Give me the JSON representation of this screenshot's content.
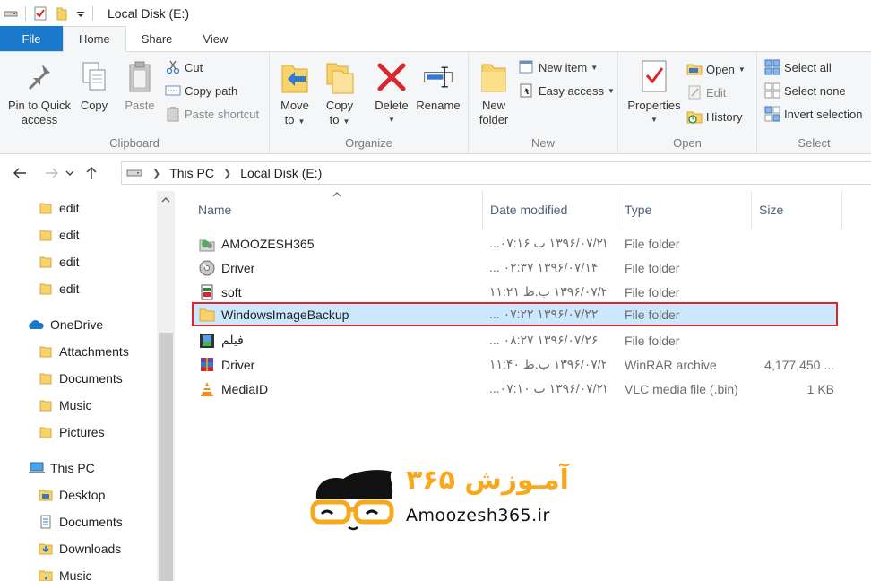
{
  "window": {
    "title": "Local Disk (E:)"
  },
  "tabs": [
    {
      "label": "File"
    },
    {
      "label": "Home"
    },
    {
      "label": "Share"
    },
    {
      "label": "View"
    }
  ],
  "ribbon": {
    "clipboard": {
      "label": "Clipboard",
      "pin_line1": "Pin to Quick",
      "pin_line2": "access",
      "copy": "Copy",
      "paste": "Paste",
      "cut": "Cut",
      "copy_path": "Copy path",
      "paste_shortcut": "Paste shortcut"
    },
    "organize": {
      "label": "Organize",
      "move_line1": "Move",
      "move_line2": "to",
      "copy_line1": "Copy",
      "copy_line2": "to",
      "delete": "Delete",
      "rename": "Rename"
    },
    "new": {
      "label": "New",
      "folder_line1": "New",
      "folder_line2": "folder",
      "new_item": "New item",
      "easy_access": "Easy access"
    },
    "open": {
      "label": "Open",
      "properties": "Properties",
      "open": "Open",
      "edit": "Edit",
      "history": "History"
    },
    "select": {
      "label": "Select",
      "select_all": "Select all",
      "select_none": "Select none",
      "invert": "Invert selection"
    }
  },
  "address": {
    "crumbs": [
      "This PC",
      "Local Disk (E:)"
    ]
  },
  "navpane": {
    "items": [
      {
        "label": "edit",
        "icon": "folder-icon"
      },
      {
        "label": "edit",
        "icon": "folder-icon"
      },
      {
        "label": "edit",
        "icon": "folder-icon"
      },
      {
        "label": "edit",
        "icon": "folder-icon"
      },
      {
        "label": "OneDrive",
        "icon": "onedrive-icon"
      },
      {
        "label": "Attachments",
        "icon": "folder-icon"
      },
      {
        "label": "Documents",
        "icon": "folder-icon"
      },
      {
        "label": "Music",
        "icon": "folder-icon"
      },
      {
        "label": "Pictures",
        "icon": "folder-icon"
      },
      {
        "label": "This PC",
        "icon": "computer-icon"
      },
      {
        "label": "Desktop",
        "icon": "desktop-folder-icon"
      },
      {
        "label": "Documents",
        "icon": "documents-folder-icon"
      },
      {
        "label": "Downloads",
        "icon": "downloads-folder-icon"
      },
      {
        "label": "Music",
        "icon": "music-folder-icon"
      }
    ]
  },
  "columns": {
    "name": "Name",
    "date": "Date modified",
    "type": "Type",
    "size": "Size"
  },
  "files": [
    {
      "name": "AMOOZESH365",
      "date": "۱۳۹۶/۰۷/۲۲ ب ۰۷:۱۶...",
      "type": "File folder",
      "size": "",
      "icon": "app-folder-icon"
    },
    {
      "name": "Driver",
      "date": "۱۳۹۶/۰۷/۱۴ ۰۲:۳۷ ...",
      "type": "File folder",
      "size": "",
      "icon": "disc-folder-icon"
    },
    {
      "name": "soft",
      "date": "۱۳۹۶/۰۷/۲۰ ب.ظ ۱۱:۲۱",
      "type": "File folder",
      "size": "",
      "icon": "doc-folder-icon"
    },
    {
      "name": "WindowsImageBackup",
      "date": "۱۳۹۶/۰۷/۲۲ ۰۷:۲۲ ...",
      "type": "File folder",
      "size": "",
      "icon": "folder-icon"
    },
    {
      "name": "فیلم",
      "date": "۱۳۹۶/۰۷/۲۶ ۰۸:۲۷ ...",
      "type": "File folder",
      "size": "",
      "icon": "film-folder-icon"
    },
    {
      "name": "Driver",
      "date": "۱۳۹۶/۰۷/۲۰ ب.ظ ۱۱:۴۰",
      "type": "WinRAR archive",
      "size": "4,177,450 ...",
      "icon": "winrar-icon"
    },
    {
      "name": "MediaID",
      "date": "۱۳۹۶/۰۷/۲۲ ب ۰۷:۱۰...",
      "type": "VLC media file (.bin)",
      "size": "1 KB",
      "icon": "vlc-icon"
    }
  ],
  "watermark": {
    "brand": "آمـوزش ۳۶۵",
    "url": "Amoozesh365.ir"
  }
}
